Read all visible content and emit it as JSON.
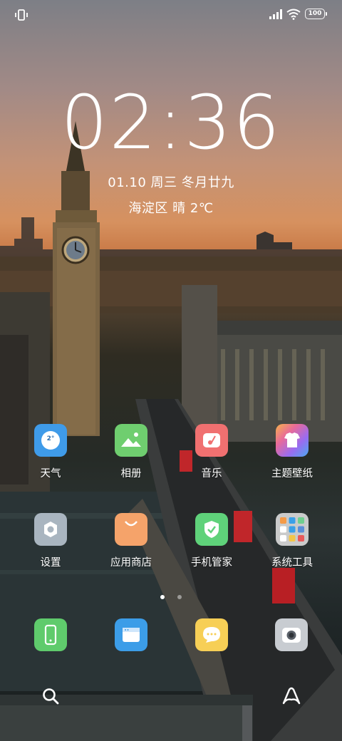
{
  "status_bar": {
    "left_icon": "vibrate-icon",
    "right_icons": [
      "signal-icon",
      "wifi-icon",
      "battery-icon"
    ],
    "battery_level": "100"
  },
  "lockscreen": {
    "time": "02:36",
    "date": "01.10 周三 冬月廿九",
    "weather": "海淀区 晴 2℃"
  },
  "apps_row1": [
    {
      "label": "天气",
      "icon": "weather-icon",
      "color": "#3f9be9",
      "badge": "2°"
    },
    {
      "label": "相册",
      "icon": "gallery-icon",
      "color": "#6fce6f"
    },
    {
      "label": "音乐",
      "icon": "music-icon",
      "color": "#f07070"
    },
    {
      "label": "主题壁纸",
      "icon": "themes-icon",
      "color": "#c86cf0"
    }
  ],
  "apps_row2": [
    {
      "label": "设置",
      "icon": "settings-icon",
      "color": "#a9b5c0"
    },
    {
      "label": "应用商店",
      "icon": "app-store-icon",
      "color": "#f5a36a"
    },
    {
      "label": "手机管家",
      "icon": "security-icon",
      "color": "#5fd27a"
    },
    {
      "label": "系统工具",
      "icon": "system-tools-folder-icon",
      "color": "#d9d9d9"
    }
  ],
  "page_indicator": {
    "pages": 2,
    "current": 1
  },
  "dock": [
    {
      "icon": "phone-icon",
      "color": "#5fcb6c"
    },
    {
      "icon": "browser-icon",
      "color": "#3c9de8"
    },
    {
      "icon": "messages-icon",
      "color": "#f7cf56"
    },
    {
      "icon": "camera-icon",
      "color": "#c8ccd1"
    }
  ],
  "bottom_bar": [
    "search-icon",
    "assistant-icon"
  ]
}
